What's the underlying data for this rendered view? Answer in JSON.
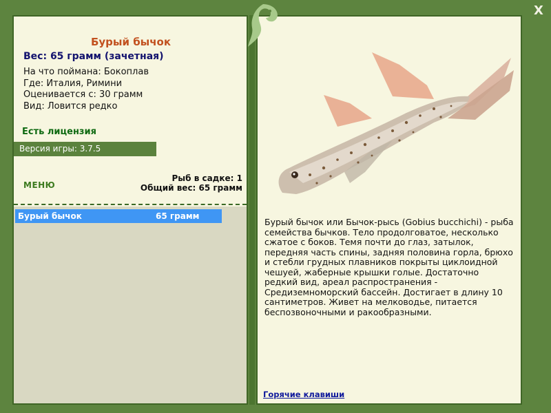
{
  "left": {
    "title": "Бурый бычок",
    "weight": "Вес: 65 грамм (зачетная)",
    "info": [
      "На что поймана: Бокоплав",
      "Где: Италия, Римини",
      "Оценивается с: 30 грамм",
      "Вид: Ловится редко"
    ],
    "license": "Есть лицензия",
    "version": "Версия игры: 3.7.5",
    "menu": "МЕНЮ",
    "fish_count": "Рыб в садке: 1",
    "total_weight": "Общий вес: 65 грамм",
    "catch_list": [
      {
        "name": "Бурый бычок",
        "weight": "65 грамм"
      }
    ]
  },
  "right": {
    "description": "Бурый бычок или Бычок-рысь (Gobius bucchichi) - рыба семейства бычков. Тело продолговатое, несколько сжатое с боков. Темя почти до глаз, затылок, передняя часть спины, задняя половина горла, брюхо и стебли грудных плавников покрыты циклоидной чешуей, жаберные крышки голые. Достаточно редкий вид, ареал распространения - Средиземноморский бассейн. Достигает в длину 10 сантиметров. Живет на мелководье, питается беспозвоночными и ракообразными.",
    "hotkeys": "Горячие клавиши"
  },
  "close_label": "X",
  "colors": {
    "frame": "#5d843f",
    "panel": "#f7f6e0",
    "title": "#c2511f",
    "weight": "#13136e",
    "license": "#0f6a12",
    "selected_row": "#3f96f4",
    "link": "#101a9c"
  },
  "icons": {
    "close": "close-icon",
    "logo": "fish-logo-icon"
  }
}
